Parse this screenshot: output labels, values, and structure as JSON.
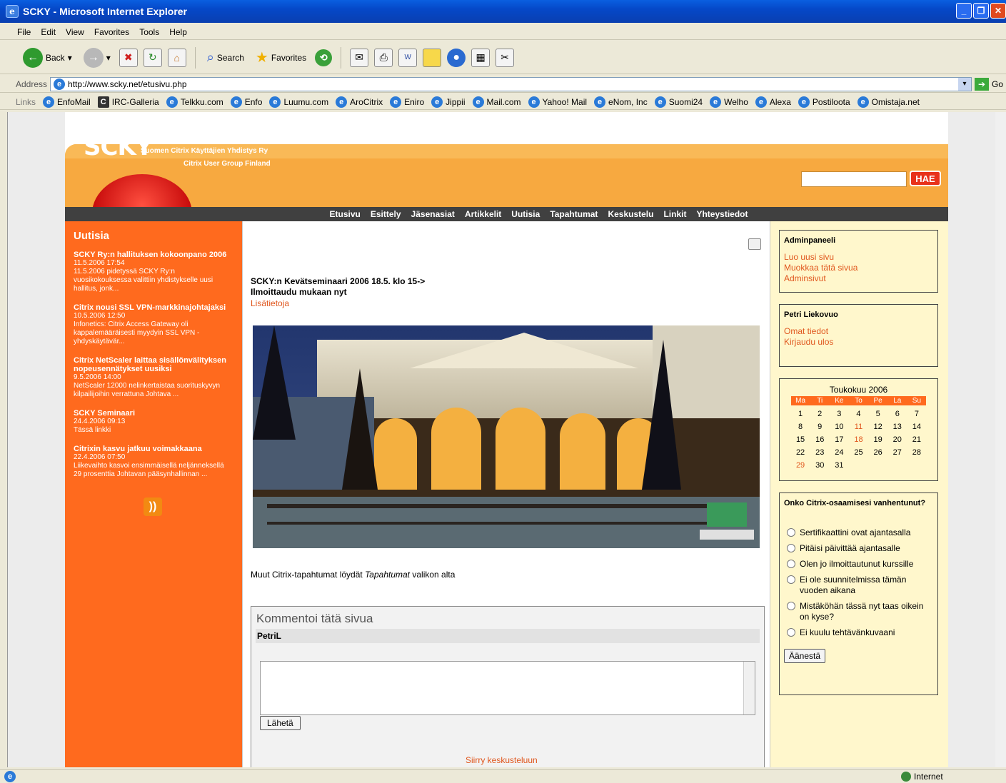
{
  "window": {
    "title": "SCKY - Microsoft Internet Explorer"
  },
  "menu": [
    "File",
    "Edit",
    "View",
    "Favorites",
    "Tools",
    "Help"
  ],
  "toolbar": {
    "back": "Back",
    "search": "Search",
    "favorites": "Favorites"
  },
  "address": {
    "label": "Address",
    "url": "http://www.scky.net/etusivu.php",
    "go": "Go"
  },
  "links": {
    "label": "Links",
    "items": [
      "EnfoMail",
      "IRC-Galleria",
      "Telkku.com",
      "Enfo",
      "Luumu.com",
      "AroCitrix",
      "Eniro",
      "Jippii",
      "Mail.com",
      "Yahoo! Mail",
      "eNom, Inc",
      "Suomi24",
      "Welho",
      "Alexa",
      "Postiloota",
      "Omistaja.net"
    ]
  },
  "status": {
    "zone": "Internet"
  },
  "site": {
    "logo": "SCKY",
    "tagline": "Suomen Citrix Käyttäjien Yhdistys Ry",
    "tagline2": "Citrix User Group Finland",
    "search_btn": "HAE",
    "nav": [
      "Etusivu",
      "Esittely",
      "Jäsenasiat",
      "Artikkelit",
      "Uutisia",
      "Tapahtumat",
      "Keskustelu",
      "Linkit",
      "Yhteystiedot"
    ]
  },
  "news": {
    "heading": "Uutisia",
    "items": [
      {
        "title": "SCKY Ry:n hallituksen kokoonpano 2006",
        "date": "11.5.2006 17:54",
        "text": "11.5.2006 pidetyssä SCKY Ry:n vuosikokouksessa valittiin yhdistykselle uusi hallitus, jonk..."
      },
      {
        "title": "Citrix nousi SSL VPN-markkinajohtajaksi",
        "date": "10.5.2006 12:50",
        "text": "Infonetics: Citrix Access Gateway oli kappalemääräisesti myydyin SSL VPN -yhdyskäytävär..."
      },
      {
        "title": "Citrix NetScaler laittaa sisällönvälityksen nopeusennätykset uusiksi",
        "date": "9.5.2006 14:00",
        "text": "NetScaler 12000 nelinkertaistaa suorituskyvyn kilpailijoihin verrattuna Johtava ..."
      },
      {
        "title": "SCKY Seminaari",
        "date": "24.4.2006 09:13",
        "text": "Tässä linkki"
      },
      {
        "title": "Citrixin kasvu jatkuu voimakkaana",
        "date": "22.4.2006 07:50",
        "text": "Liikevaihto kasvoi ensimmäisellä neljänneksellä 29 prosenttia Johtavan pääsynhallinnan ..."
      }
    ]
  },
  "main": {
    "event_title1": "SCKY:n Kevätseminaari 2006 18.5. klo 15->",
    "event_title2": "Ilmoittaudu mukaan nyt",
    "more": "Lisätietoja",
    "muut_pre": "Muut Citrix-tapahtumat löydät ",
    "muut_em": "Tapahtumat",
    "muut_post": " valikon alta",
    "comment_heading": "Kommentoi tätä sivua",
    "comment_user": "PetriL",
    "send": "Lähetä",
    "goto_forum": "Siirry keskusteluun"
  },
  "admin": {
    "heading": "Adminpaneeli",
    "links": [
      "Luo uusi sivu",
      "Muokkaa tätä sivua",
      "Adminsivut"
    ]
  },
  "user": {
    "heading": "Petri Liekovuo",
    "links": [
      "Omat tiedot",
      "Kirjaudu ulos"
    ]
  },
  "calendar": {
    "caption": "Toukokuu 2006",
    "days": [
      "Ma",
      "Ti",
      "Ke",
      "To",
      "Pe",
      "La",
      "Su"
    ],
    "rows": [
      [
        "1",
        "2",
        "3",
        "4",
        "5",
        "6",
        "7"
      ],
      [
        "8",
        "9",
        "10",
        "11",
        "12",
        "13",
        "14"
      ],
      [
        "15",
        "16",
        "17",
        "18",
        "19",
        "20",
        "21"
      ],
      [
        "22",
        "23",
        "24",
        "25",
        "26",
        "27",
        "28"
      ],
      [
        "29",
        "30",
        "31",
        "",
        "",
        "",
        ""
      ]
    ]
  },
  "poll": {
    "heading": "Onko Citrix-osaamisesi vanhentunut?",
    "options": [
      "Sertifikaattini ovat ajantasalla",
      "Pitäisi päivittää ajantasalle",
      "Olen jo ilmoittautunut kurssille",
      "Ei ole suunnitelmissa tämän vuoden aikana",
      "Mistäköhän tässä nyt taas oikein on kyse?",
      "Ei kuulu tehtävänkuvaani"
    ],
    "vote": "Äänestä"
  }
}
